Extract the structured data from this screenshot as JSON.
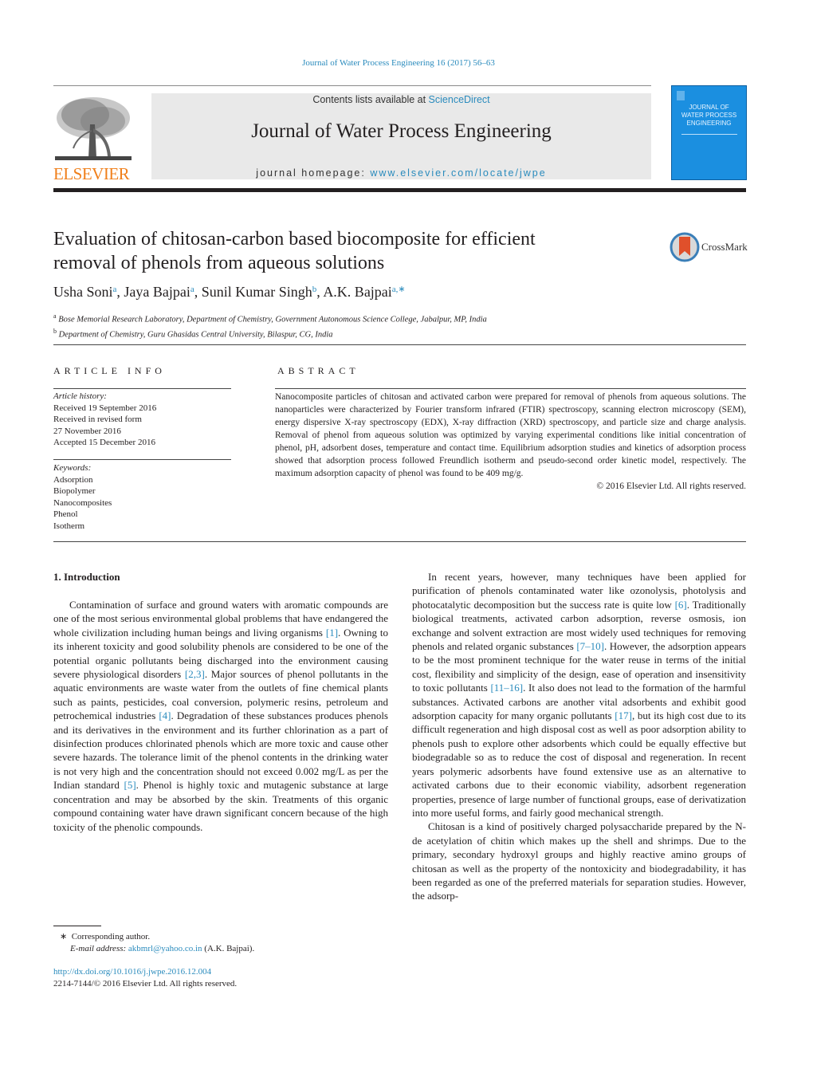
{
  "header": {
    "citation": "Journal of Water Process Engineering 16 (2017) 56–63",
    "contents_prefix": "Contents lists available at ",
    "contents_link": "ScienceDirect",
    "journal_title": "Journal of Water Process Engineering",
    "homepage_prefix": "journal homepage: ",
    "homepage_link": "www.elsevier.com/locate/jwpe",
    "publisher_logo_text": "ELSEVIER",
    "cover_lines": [
      "JOURNAL OF",
      "WATER PROCESS",
      "ENGINEERING"
    ],
    "brand_color": "#f07f1a",
    "link_color": "#2a8bbd",
    "cover_color": "#1b8fe0"
  },
  "article": {
    "title_line1": "Evaluation of chitosan-carbon based biocomposite for efficient",
    "title_line2": "removal of phenols from aqueous solutions",
    "crossmark_label": "CrossMark",
    "authors": [
      {
        "name": "Usha Soni",
        "sup": "a"
      },
      {
        "name": "Jaya Bajpai",
        "sup": "a"
      },
      {
        "name": "Sunil Kumar Singh",
        "sup": "b"
      },
      {
        "name": "A.K. Bajpai",
        "sup": "a,∗"
      }
    ],
    "affiliations": [
      {
        "mark": "a",
        "text": "Bose Memorial Research Laboratory, Department of Chemistry, Government Autonomous Science College, Jabalpur, MP, India"
      },
      {
        "mark": "b",
        "text": "Department of Chemistry, Guru Ghasidas Central University, Bilaspur, CG, India"
      }
    ]
  },
  "article_info": {
    "label": "ARTICLE INFO",
    "history_head": "Article history:",
    "history": [
      "Received 19 September 2016",
      "Received in revised form",
      "27 November 2016",
      "Accepted 15 December 2016"
    ],
    "keywords_head": "Keywords:",
    "keywords": [
      "Adsorption",
      "Biopolymer",
      "Nanocomposites",
      "Phenol",
      "Isotherm"
    ]
  },
  "abstract": {
    "label": "ABSTRACT",
    "text": "Nanocomposite particles of chitosan and activated carbon were prepared for removal of phenols from aqueous solutions. The nanoparticles were characterized by Fourier transform infrared (FTIR) spectroscopy, scanning electron microscopy (SEM), energy dispersive X-ray spectroscopy (EDX), X-ray diffraction (XRD) spectroscopy, and particle size and charge analysis. Removal of phenol from aqueous solution was optimized by varying experimental conditions like initial concentration of phenol, pH, adsorbent doses, temperature and contact time. Equilibrium adsorption studies and kinetics of adsorption process showed that adsorption process followed Freundlich isotherm and pseudo-second order kinetic model, respectively. The maximum adsorption capacity of phenol was found to be 409 mg/g.",
    "copyright": "© 2016 Elsevier Ltd. All rights reserved."
  },
  "body": {
    "section_heading": "1.  Introduction",
    "left_paragraphs": [
      [
        {
          "t": "Contamination of surface and ground waters with aromatic compounds are one of the most serious environmental global problems that have endangered the whole civilization including human beings and living organisms "
        },
        {
          "ref": "[1]"
        },
        {
          "t": ". Owning to its inherent toxicity and good solubility phenols are considered to be one of the potential organic pollutants being discharged into the environment causing severe physiological disorders "
        },
        {
          "ref": "[2,3]"
        },
        {
          "t": ". Major sources of phenol pollutants in the aquatic environments are waste water from the outlets of fine chemical plants such as paints, pesticides, coal conversion, polymeric resins, petroleum and petrochemical industries "
        },
        {
          "ref": "[4]"
        },
        {
          "t": ". Degradation of these substances produces phenols and its derivatives in the environment and its further chlorination as a part of disinfection produces chlorinated phenols which are more toxic and cause other severe hazards. The tolerance limit of the phenol contents in the drinking water is not very high and the concentration should not exceed 0.002 mg/L as per the Indian standard "
        },
        {
          "ref": "[5]"
        },
        {
          "t": ". Phenol is highly toxic and mutagenic substance at large concentration and may be absorbed by the skin. Treatments of this organic compound containing water have drawn significant concern because of the high toxicity of the phenolic compounds."
        }
      ]
    ],
    "right_paragraphs": [
      [
        {
          "t": "In recent years, however, many techniques have been applied for purification of phenols contaminated water like ozonolysis, photolysis and photocatalytic decomposition but the success rate is quite low "
        },
        {
          "ref": "[6]"
        },
        {
          "t": ". Traditionally biological treatments, activated carbon adsorption, reverse osmosis, ion exchange and solvent extraction are most widely used techniques for removing phenols and related organic substances "
        },
        {
          "ref": "[7–10]"
        },
        {
          "t": ". However, the adsorption appears to be the most prominent technique for the water reuse in terms of the initial cost, flexibility and simplicity of the design, ease of operation and insensitivity to toxic pollutants "
        },
        {
          "ref": "[11–16]"
        },
        {
          "t": ". It also does not lead to the formation of the harmful substances. Activated carbons are another vital adsorbents and exhibit good adsorption capacity for many organic pollutants "
        },
        {
          "ref": "[17]"
        },
        {
          "t": ", but its high cost due to its difficult regeneration and high disposal cost as well as poor adsorption ability to phenols push to explore other adsorbents which could be equally effective but biodegradable so as to reduce the cost of disposal and regeneration. In recent years polymeric adsorbents have found extensive use as an alternative to activated carbons due to their economic viability, adsorbent regeneration properties, presence of large number of functional groups, ease of derivatization into more useful forms, and fairly good mechanical strength."
        }
      ],
      [
        {
          "t": "Chitosan is a kind of positively charged polysaccharide prepared by the N-de acetylation of chitin which makes up the shell and shrimps. Due to the primary, secondary hydroxyl groups and highly reactive amino groups of chitosan as well as the property of the nontoxicity and biodegradability, it has been regarded as one of the preferred materials for separation studies. However, the adsorp-"
        }
      ]
    ]
  },
  "footnotes": {
    "corresponding_mark": "∗",
    "corresponding_text": "Corresponding author.",
    "email_label": "E-mail address:",
    "email": "akbmrl@yahoo.co.in",
    "email_suffix": "(A.K. Bajpai).",
    "doi": "http://dx.doi.org/10.1016/j.jwpe.2016.12.004",
    "issn_line": "2214-7144/© 2016 Elsevier Ltd. All rights reserved."
  }
}
